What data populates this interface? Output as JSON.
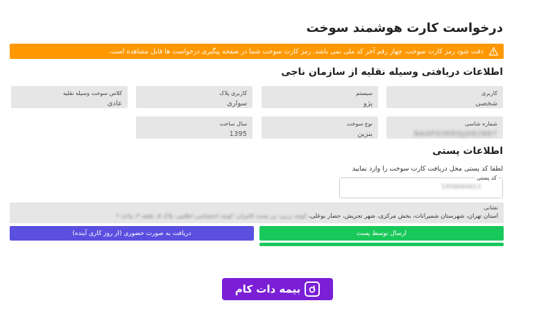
{
  "page": {
    "title": "درخواست کارت هوشمند سوخت"
  },
  "alert": {
    "text": "دقت شود رمز کارت سوخت، چهار رقم آخر کد ملی نمی باشد. رمز کارت سوخت شما در صفحه پیگیری درخواست ها قابل مشاهده است.",
    "color": "#ff9800"
  },
  "vehicle": {
    "title": "اطلاعات دریافتی وسیله نقلیه از سازمان ناجی",
    "fields": [
      {
        "label": "کاربری",
        "value": "شخصی"
      },
      {
        "label": "سیستم",
        "value": "پژو"
      },
      {
        "label": "کاربری پلاک",
        "value": "سواری"
      },
      {
        "label": "کلاس سوخت وسیله نقلیه",
        "value": "عادی"
      },
      {
        "label": "شماره شاسی",
        "value": "NAAP03EE0JJ082887"
      },
      {
        "label": "نوع سوخت",
        "value": "بنزین"
      },
      {
        "label": "سال ساخت",
        "value": "1395"
      }
    ]
  },
  "postal": {
    "title": "اطلاعات پستی",
    "hint": "لطفا کد پستی محل دریافت کارت سوخت را وارد نمایید",
    "code_label": "کد پستی",
    "code_value": "1958684813",
    "address_label": "نشانی",
    "address_clear": "استان تهران، شهرستان شمیرانات، بخش مرکزی، شهر تجریش، حصار بوعلی،",
    "address_blurred": "کوچه زرین، بن بست کامران، کوچه اختصاصی اطلس، پلاک ۵، طبقه ۳، واحد ۲"
  },
  "actions": {
    "send_by_post": "ارسال توسط پست",
    "in_person": "دریافت به صورت حضوری (از روز کاری آینده)"
  },
  "brand": {
    "name": "بیمه دات کام",
    "color": "#7b1fd6"
  }
}
